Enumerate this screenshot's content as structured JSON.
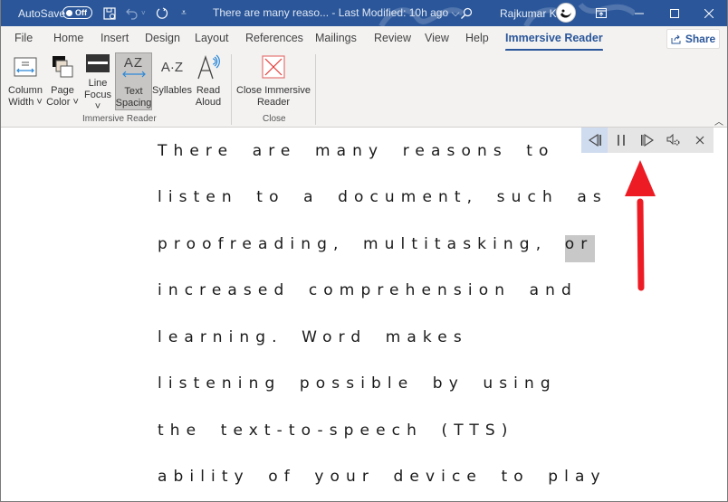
{
  "titlebar": {
    "autosave_label": "AutoSave",
    "autosave_state": "Off",
    "doc_title": "There are many reaso...  -  Last Modified: 10h ago  ⌵",
    "user_name": "Rajkumar K",
    "icons": [
      "save-icon",
      "undo-icon",
      "redo-icon",
      "customize-quick-access-icon",
      "search-icon",
      "ribbon-display-options-icon",
      "minimize-icon",
      "maximize-icon",
      "close-icon"
    ],
    "color": "#2b579a"
  },
  "tabs": [
    {
      "label": "File"
    },
    {
      "label": "Home"
    },
    {
      "label": "Insert"
    },
    {
      "label": "Design"
    },
    {
      "label": "Layout"
    },
    {
      "label": "References"
    },
    {
      "label": "Mailings"
    },
    {
      "label": "Review"
    },
    {
      "label": "View"
    },
    {
      "label": "Help"
    },
    {
      "label": "Immersive Reader",
      "active": true
    }
  ],
  "share_label": "Share",
  "ribbon": {
    "groups": [
      {
        "label": "Immersive Reader",
        "buttons": [
          {
            "line1": "Column",
            "line2": "Width ˅",
            "icon": "column-width-icon"
          },
          {
            "line1": "Page",
            "line2": "Color ˅",
            "icon": "page-color-icon"
          },
          {
            "line1": "Line",
            "line2": "Focus ˅",
            "icon": "line-focus-icon"
          },
          {
            "line1": "Text",
            "line2": "Spacing",
            "icon": "text-spacing-icon",
            "selected": true
          },
          {
            "line1": "Syllables",
            "line2": "",
            "icon": "syllables-icon"
          },
          {
            "line1": "Read",
            "line2": "Aloud",
            "icon": "read-aloud-icon"
          }
        ]
      },
      {
        "label": "Close",
        "buttons": [
          {
            "line1": "Close Immersive",
            "line2": "Reader",
            "icon": "close-immersive-reader-icon"
          }
        ]
      }
    ],
    "icon_glyphs": {
      "text_spacing": "AZ",
      "syllables": "A·Z",
      "read_aloud": "A"
    }
  },
  "document": {
    "lines": [
      "There are many reasons to",
      "listen to a document, such as",
      "proofreading, multitasking,",
      "increased comprehension and",
      "learning. Word makes",
      "listening possible by using",
      "the text-to-speech (TTS)",
      "ability of your device to play"
    ],
    "highlighted_word": "or",
    "highlight_color": "#c8c8c8"
  },
  "reader_toolbar": {
    "buttons": [
      {
        "name": "previous-paragraph",
        "icon": "previous-icon",
        "active": true
      },
      {
        "name": "pause",
        "icon": "pause-icon"
      },
      {
        "name": "next-paragraph",
        "icon": "next-icon"
      },
      {
        "name": "reading-settings",
        "icon": "voice-settings-icon"
      },
      {
        "name": "stop-reading",
        "icon": "close-icon"
      }
    ]
  },
  "annotation": {
    "type": "arrow",
    "color": "#ed1c24",
    "points_to": "reader-toolbar"
  }
}
